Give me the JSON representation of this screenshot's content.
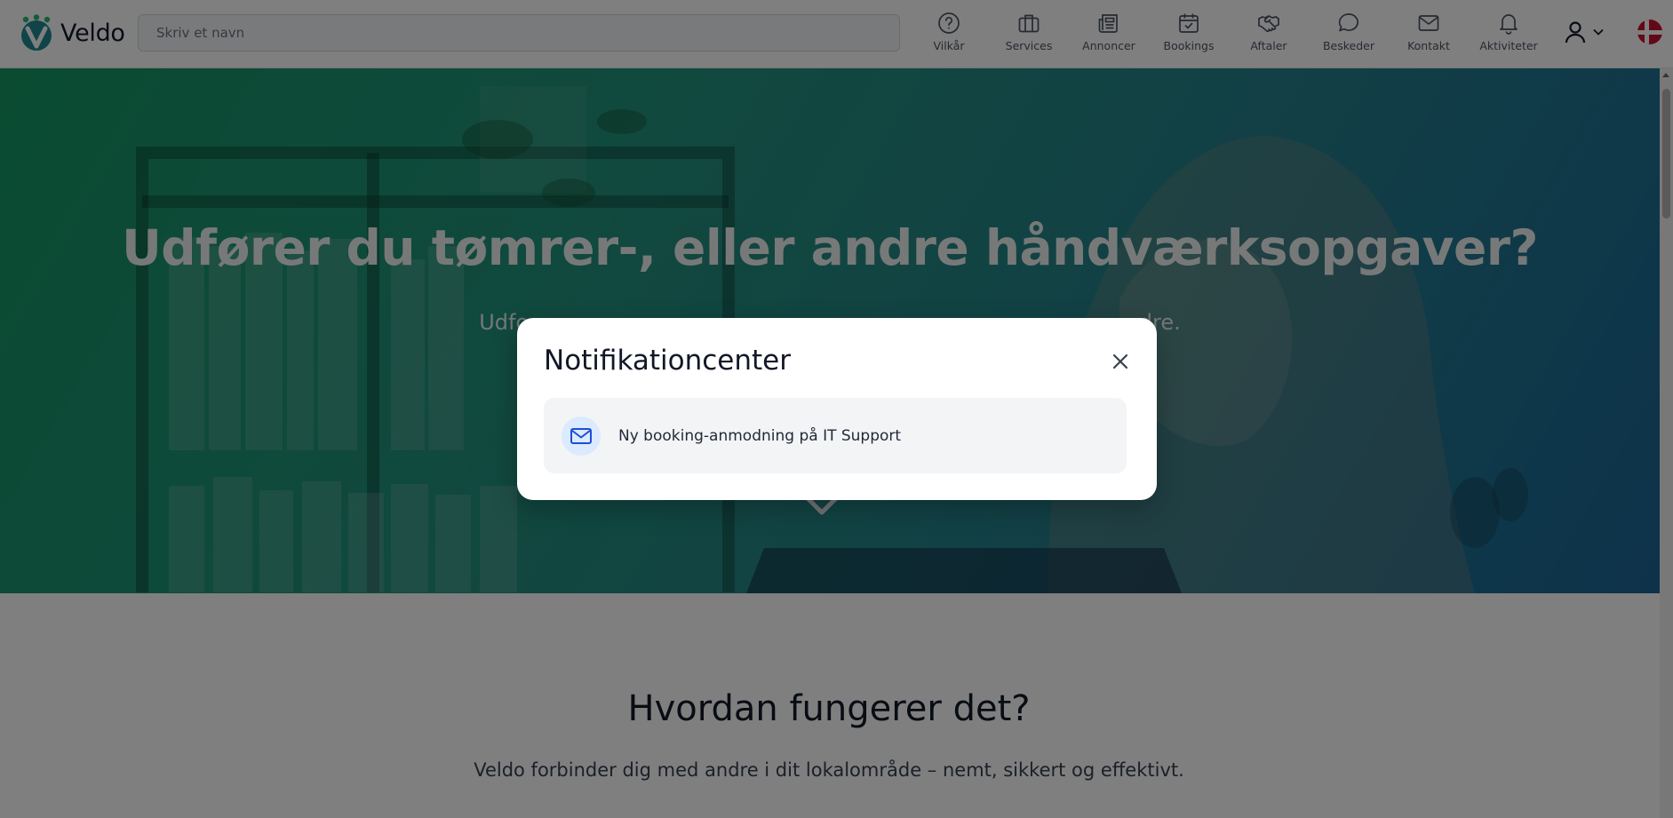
{
  "header": {
    "logo_text": "Veldo",
    "search_placeholder": "Skriv et navn",
    "nav": [
      {
        "label": "Vilkår",
        "icon": "question-circle-icon"
      },
      {
        "label": "Services",
        "icon": "briefcase-icon"
      },
      {
        "label": "Annoncer",
        "icon": "newspaper-icon"
      },
      {
        "label": "Bookings",
        "icon": "calendar-check-icon"
      },
      {
        "label": "Aftaler",
        "icon": "handshake-icon"
      },
      {
        "label": "Beskeder",
        "icon": "chat-bubble-icon"
      },
      {
        "label": "Kontakt",
        "icon": "mail-icon"
      },
      {
        "label": "Aktiviteter",
        "icon": "bell-icon"
      }
    ],
    "user_icon": "user-icon",
    "language_flag": "denmark-flag-icon"
  },
  "hero": {
    "title": "Udfører du tømrer-, eller andre håndværksopgaver?",
    "subtitle": "Udfo                                                                                          dre."
  },
  "how_it_works": {
    "title": "Hvordan fungerer det?",
    "subtitle": "Veldo forbinder dig med andre i dit lokalområde – nemt, sikkert og effektivt."
  },
  "modal": {
    "title": "Notifikationcenter",
    "notifications": [
      {
        "text": "Ny booking-anmodning på IT Support",
        "icon": "mail-icon"
      }
    ]
  },
  "colors": {
    "brand_teal": "#1f8a8a",
    "hero_gradient_start": "#18a86e",
    "hero_gradient_end": "#1f6fa8",
    "notification_icon_bg": "#dbeafe",
    "notification_icon": "#1d4ed8",
    "flag_red": "#c8102e"
  }
}
